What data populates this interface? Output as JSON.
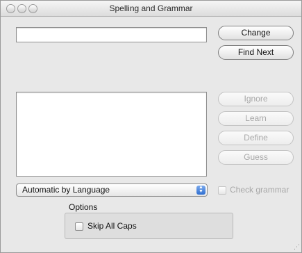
{
  "window": {
    "title": "Spelling and Grammar"
  },
  "buttons": {
    "change": "Change",
    "find_next": "Find Next",
    "ignore": "Ignore",
    "learn": "Learn",
    "define": "Define",
    "guess": "Guess"
  },
  "word_field": {
    "value": ""
  },
  "suggestions": [],
  "language_popup": {
    "selected": "Automatic by Language"
  },
  "check_grammar": {
    "label": "Check grammar",
    "checked": false
  },
  "options": {
    "title": "Options",
    "skip_all_caps": {
      "label": "Skip All Caps",
      "checked": false
    }
  }
}
